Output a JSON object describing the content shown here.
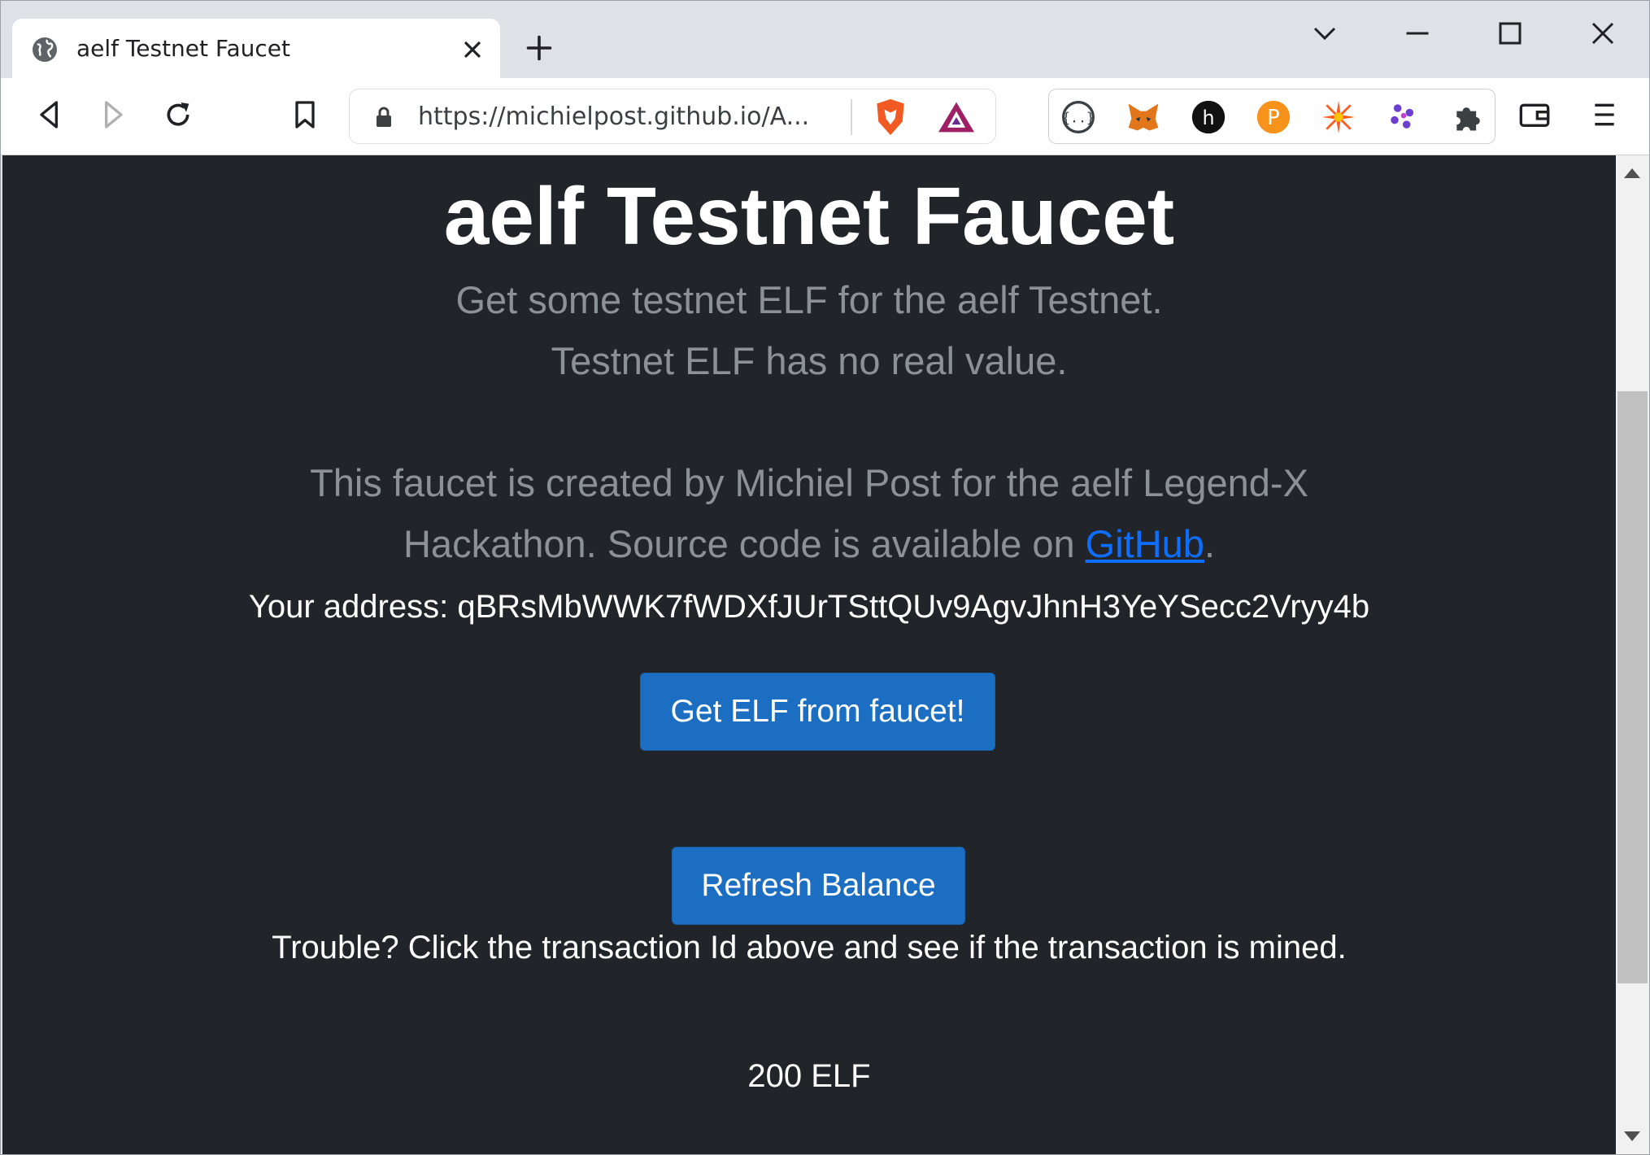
{
  "browser": {
    "tab_title": "aelf Testnet Faucet",
    "url": "https://michielpost.github.io/A...",
    "icons": {
      "tab": "globe-icon",
      "close": "close-icon",
      "new_tab": "plus-icon",
      "back": "back-icon",
      "forward": "forward-icon",
      "reload": "reload-icon",
      "bookmark": "bookmark-icon",
      "lock": "lock-icon",
      "brave": "brave-shields-icon",
      "rewards": "brave-rewards-icon",
      "wallet": "wallet-icon",
      "menu": "hamburger-menu-icon"
    },
    "extensions": [
      "json-formatter-icon",
      "metamask-icon",
      "hive-icon",
      "polkadot-icon",
      "spark-icon",
      "dots-icon",
      "extensions-puzzle-icon"
    ],
    "window_controls": [
      "chevron-down-icon",
      "minimize-icon",
      "maximize-icon",
      "close-window-icon"
    ]
  },
  "page": {
    "title": "aelf Testnet Faucet",
    "lead_line1": "Get some testnet ELF for the aelf Testnet.",
    "lead_line2": "Testnet ELF has no real value.",
    "credit_line1": "This faucet is created by Michiel Post for the aelf Legend-X",
    "credit_line2_prefix": "Hackathon. Source code is available on ",
    "credit_link": "GitHub",
    "credit_line2_suffix": ".",
    "address_label": "Your address:",
    "address_value": "qBRsMbWWK7fWDXfJUrTSttQUv9AgvJhnH3YeYSecc2Vryy4b",
    "faucet_button": "Get ELF from faucet!",
    "refresh_button": "Refresh Balance",
    "trouble_text": "Trouble? Click the transaction Id above and see if the transaction is mined.",
    "balance": "200 ELF"
  },
  "colors": {
    "page_bg": "#212529",
    "button_bg": "#1b6ec2",
    "muted_text": "#8c9196",
    "link": "#0d6efd"
  }
}
